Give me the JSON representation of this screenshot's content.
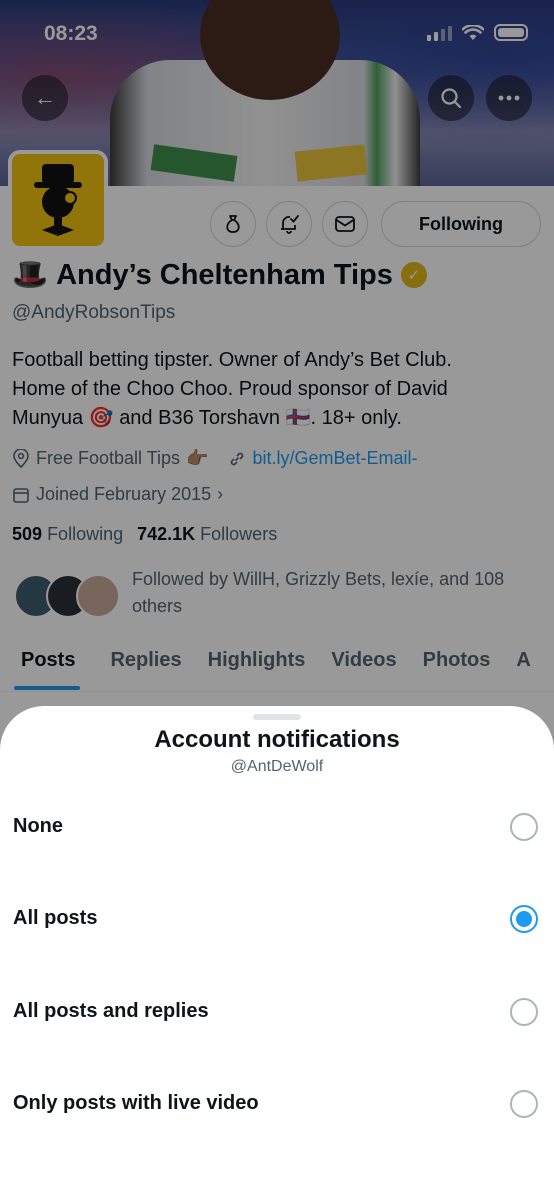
{
  "status_bar": {
    "time": "08:23"
  },
  "profile": {
    "name_emoji": "🎩",
    "name": "Andy’s Cheltenham Tips",
    "handle": "@AndyRobsonTips",
    "following_button": "Following",
    "bio": {
      "line1": "Football betting tipster. Owner of Andy’s Bet Club.",
      "line2": "Home of the Choo Choo. Proud sponsor of David",
      "line3_a": "Munyua",
      "line3_emoji1": "🎯",
      "line3_b": "and B36 Torshavn",
      "line3_emoji2": "🇫🇴",
      "line3_c": ". 18+ only."
    },
    "location": "Free Football Tips",
    "location_emoji": "👉🏽",
    "website": "bit.ly/GemBet-Email-",
    "joined": "Joined February 2015",
    "following_count": "509",
    "following_label": "Following",
    "followers_count": "742.1K",
    "followers_label": "Followers",
    "followed_by": "Followed by WillH, Grizzly Bets, lexíe, and 108 others",
    "tabs": [
      "Posts",
      "Replies",
      "Highlights",
      "Videos",
      "Photos",
      "A"
    ]
  },
  "sheet": {
    "title": "Account notifications",
    "subtitle": "@AntDeWolf",
    "options": [
      {
        "label": "None",
        "selected": false
      },
      {
        "label": "All posts",
        "selected": true
      },
      {
        "label": "All posts and replies",
        "selected": false
      },
      {
        "label": "Only posts with live video",
        "selected": false
      }
    ]
  },
  "colors": {
    "accent": "#1d9bf0",
    "verified": "#e2b719",
    "avatar_bg": "#f2c313"
  }
}
